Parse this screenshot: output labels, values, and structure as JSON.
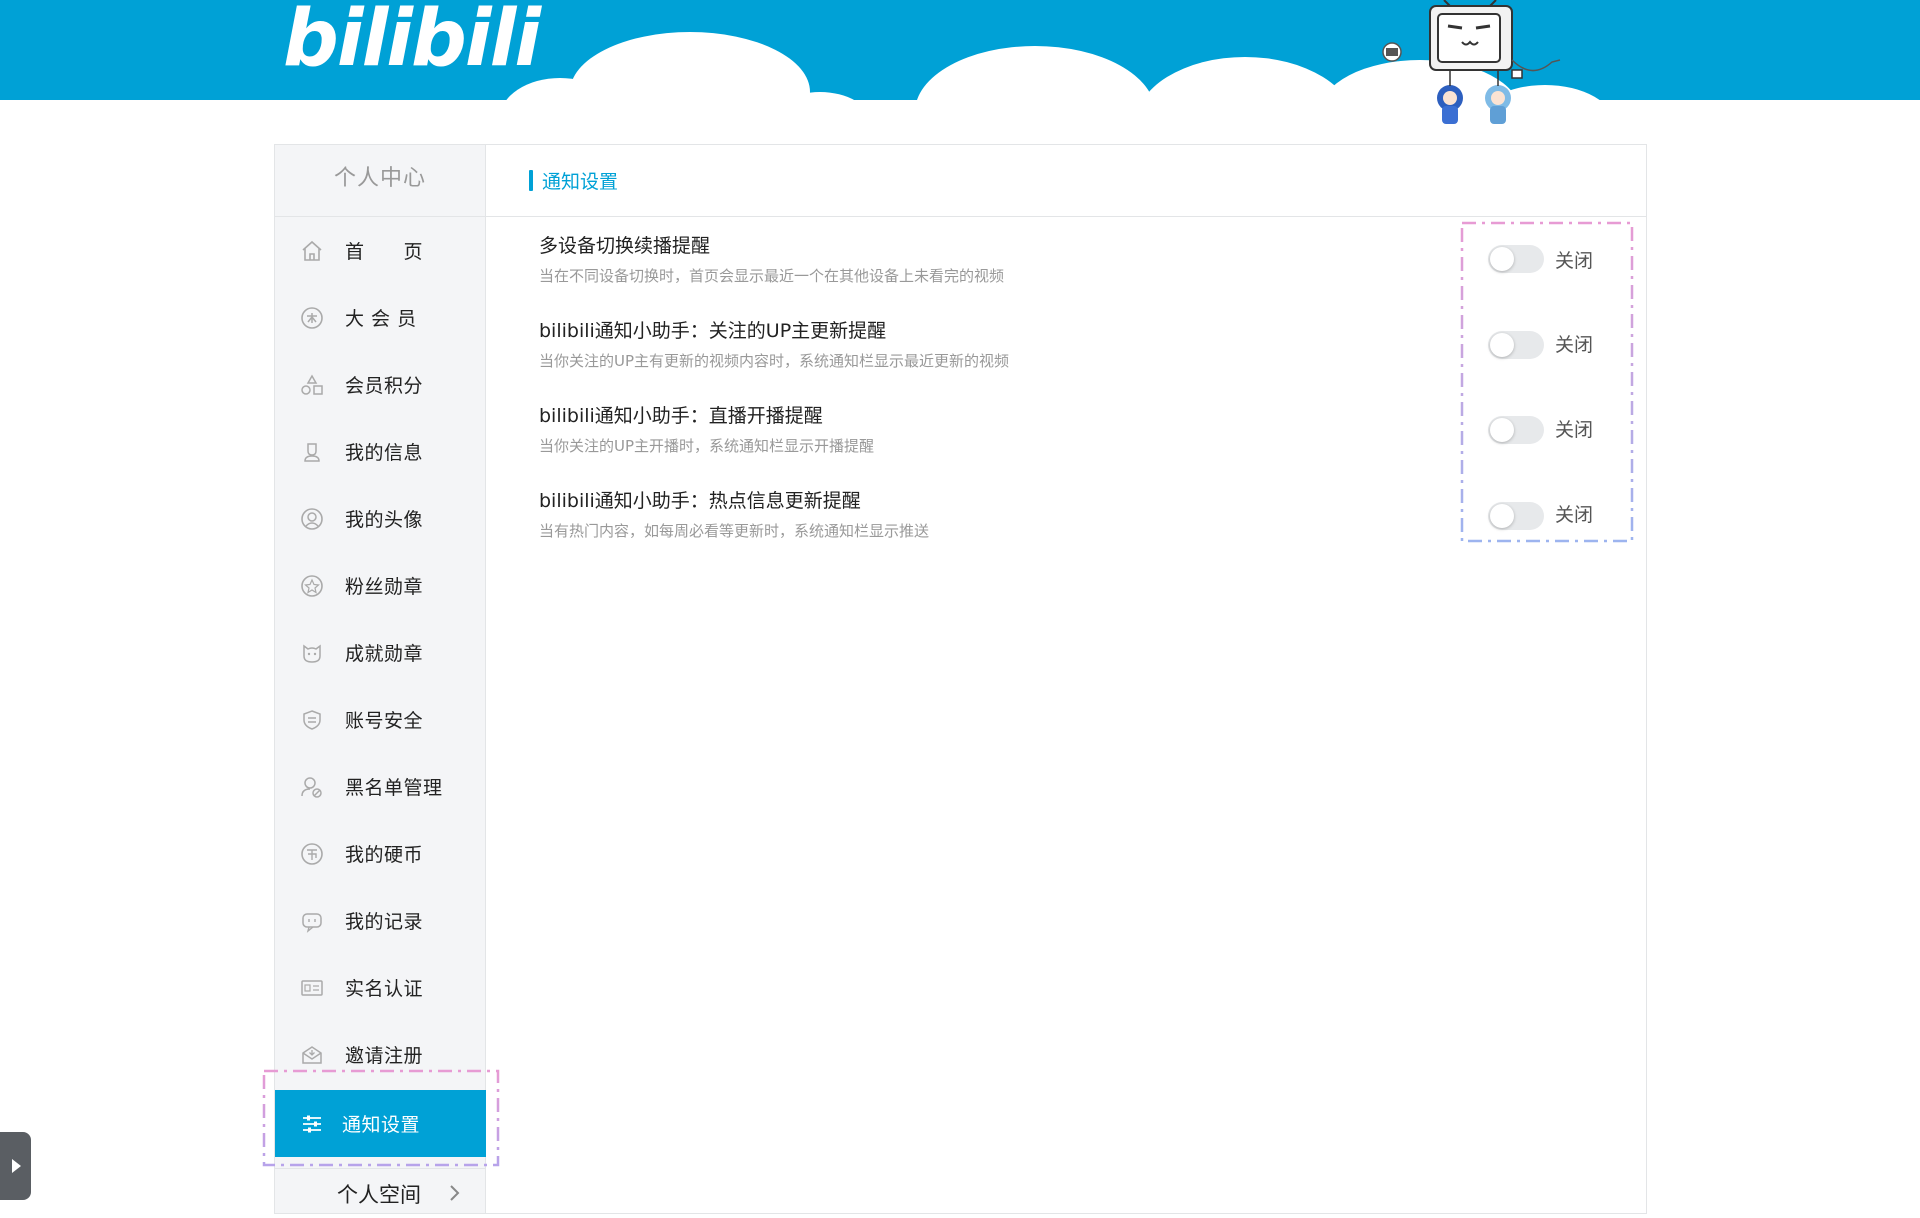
{
  "brand": {
    "logo_text": "bilibili",
    "accent": "#00a1d6"
  },
  "sidebar": {
    "title": "个人中心",
    "items": [
      {
        "label": "首　　页",
        "icon": "home-icon"
      },
      {
        "label": "大 会 员",
        "icon": "vip-icon"
      },
      {
        "label": "会员积分",
        "icon": "points-icon"
      },
      {
        "label": "我的信息",
        "icon": "user-icon"
      },
      {
        "label": "我的头像",
        "icon": "avatar-icon"
      },
      {
        "label": "粉丝勋章",
        "icon": "fan-medal-icon"
      },
      {
        "label": "成就勋章",
        "icon": "achievement-icon"
      },
      {
        "label": "账号安全",
        "icon": "shield-icon"
      },
      {
        "label": "黑名单管理",
        "icon": "blacklist-icon"
      },
      {
        "label": "我的硬币",
        "icon": "coin-icon"
      },
      {
        "label": "我的记录",
        "icon": "record-icon"
      },
      {
        "label": "实名认证",
        "icon": "id-card-icon"
      },
      {
        "label": "邀请注册",
        "icon": "invite-icon"
      },
      {
        "label": "通知设置",
        "icon": "settings-sliders-icon",
        "active": true
      }
    ],
    "bottom_link": "个人空间"
  },
  "content": {
    "section_title": "通知设置",
    "settings": [
      {
        "title": "多设备切换续播提醒",
        "desc": "当在不同设备切换时，首页会显示最近一个在其他设备上未看完的视频",
        "state": "关闭",
        "enabled": false
      },
      {
        "title": "bilibili通知小助手：关注的UP主更新提醒",
        "desc": "当你关注的UP主有更新的视频内容时，系统通知栏显示最近更新的视频",
        "state": "关闭",
        "enabled": false
      },
      {
        "title": "bilibili通知小助手：直播开播提醒",
        "desc": "当你关注的UP主开播时，系统通知栏显示开播提醒",
        "state": "关闭",
        "enabled": false
      },
      {
        "title": "bilibili通知小助手：热点信息更新提醒",
        "desc": "当有热门内容，如每周必看等更新时，系统通知栏显示推送",
        "state": "关闭",
        "enabled": false
      }
    ]
  }
}
